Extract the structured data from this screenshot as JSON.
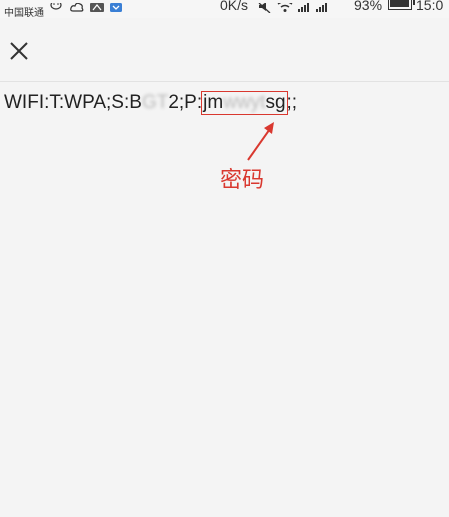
{
  "status_bar": {
    "carrier": "中国联通",
    "network_speed": "0K/s",
    "battery_percent": "93%",
    "clock": "15:0",
    "icons": [
      "wechat-icon",
      "cloud-icon",
      "huawei-icon",
      "app-icon",
      "mute-icon",
      "wifi-icon",
      "signal-icon",
      "battery-icon"
    ]
  },
  "top_bar": {
    "close_icon": "close-icon"
  },
  "content": {
    "wifi_prefix": "WIFI:T:WPA;S:B",
    "ssid_hidden": "GT",
    "ssid_suffix": "2;P:",
    "password_start": "jm",
    "password_hidden": "wwyt",
    "password_end": "sg",
    "wifi_suffix": ";;"
  },
  "annotation": {
    "label": "密码",
    "color": "#d9382f"
  }
}
